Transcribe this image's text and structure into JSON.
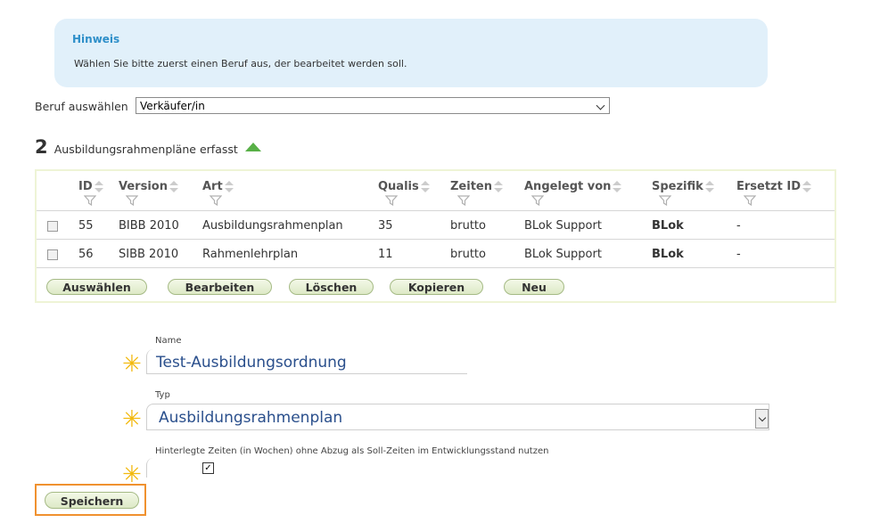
{
  "hint": {
    "title": "Hinweis",
    "text": "Wählen Sie bitte zuerst einen Beruf aus, der bearbeitet werden soll."
  },
  "beruf": {
    "label": "Beruf auswählen",
    "selected": "Verkäufer/in"
  },
  "summary": {
    "count": "2",
    "label": "Ausbildungsrahmenpläne erfasst"
  },
  "table": {
    "columns": [
      "ID",
      "Version",
      "Art",
      "Qualis",
      "Zeiten",
      "Angelegt von",
      "Spezifik",
      "Ersetzt ID"
    ],
    "rows": [
      [
        "55",
        "BIBB 2010",
        "Ausbildungsrahmenplan",
        "35",
        "brutto",
        "BLok Support",
        "BLok",
        "-"
      ],
      [
        "56",
        "SIBB 2010",
        "Rahmenlehrplan",
        "11",
        "brutto",
        "BLok Support",
        "BLok",
        "-"
      ]
    ],
    "buttons": [
      "Auswählen",
      "Bearbeiten",
      "Löschen",
      "Kopieren",
      "Neu"
    ]
  },
  "form": {
    "name_label": "Name",
    "name_value": "Test-Ausbildungsordnung",
    "typ_label": "Typ",
    "typ_value": "Ausbildungsrahmenplan",
    "zeiten_label": "Hinterlegte Zeiten (in Wochen) ohne Abzug als Soll-Zeiten im Entwicklungsstand nutzen",
    "zeiten_checked": true,
    "required_mark": "✳",
    "save_label": "Speichern"
  },
  "colors": {
    "hint_bg": "#e1f0fa",
    "hint_title": "#2e8fc9",
    "accent_green": "#58b047",
    "required_star": "#f2b90f",
    "focus_frame": "#f0912f"
  }
}
